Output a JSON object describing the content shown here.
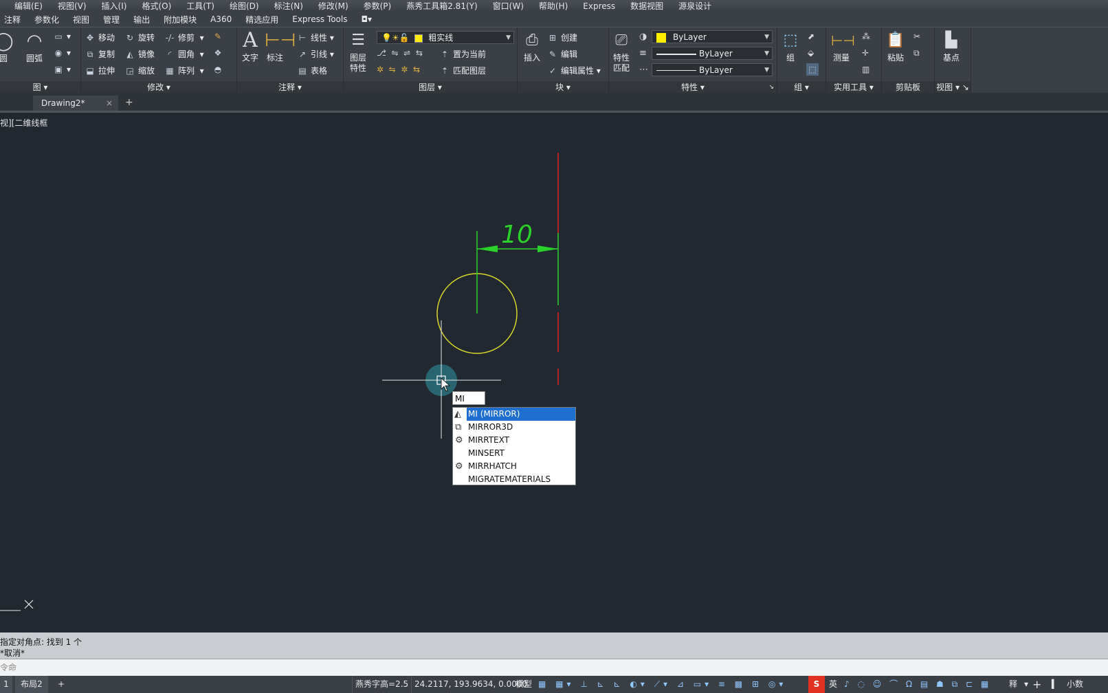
{
  "menubar": [
    "编辑(E)",
    "视图(V)",
    "插入(I)",
    "格式(O)",
    "工具(T)",
    "绘图(D)",
    "标注(N)",
    "修改(M)",
    "参数(P)",
    "燕秀工具箱2.81(Y)",
    "窗口(W)",
    "帮助(H)",
    "Express",
    "数据视图",
    "源泉设计"
  ],
  "ribbon_tabs": [
    "注释",
    "参数化",
    "视图",
    "管理",
    "输出",
    "附加模块",
    "A360",
    "精选应用",
    "Express Tools"
  ],
  "panels": {
    "draw": {
      "label": "图",
      "circle": "圆",
      "arc": "圆弧"
    },
    "modify": {
      "label": "修改",
      "move": "移动",
      "rotate": "旋转",
      "trim": "修剪",
      "copy": "复制",
      "mirror": "镜像",
      "fillet": "圆角",
      "stretch": "拉伸",
      "scale": "缩放",
      "array": "阵列"
    },
    "annotation": {
      "label": "注释",
      "text": "文字",
      "dimension": "标注",
      "linear": "线性",
      "leader": "引线",
      "table": "表格"
    },
    "layers": {
      "label": "图层",
      "layer_props": "图层\n特性",
      "current_layer": "粗实线",
      "set_current": "置为当前",
      "match_layer": "匹配图层"
    },
    "block": {
      "label": "块",
      "insert": "插入",
      "create": "创建",
      "edit": "编辑",
      "edit_attr": "编辑属性"
    },
    "properties": {
      "label": "特性",
      "match": "特性\n匹配",
      "color": "ByLayer",
      "linetype": "ByLayer",
      "lineweight": "ByLayer"
    },
    "groups": {
      "label": "组",
      "group": "组"
    },
    "utilities": {
      "label": "实用工具",
      "measure": "测量"
    },
    "clipboard": {
      "label": "剪贴板",
      "paste": "粘贴"
    },
    "view": {
      "label": "视图",
      "base": "基点"
    }
  },
  "doc_tab": {
    "name": "Drawing2*",
    "close": "×",
    "add": "+"
  },
  "viewport_label": "视][二维线框",
  "drawing": {
    "dimension_text": "10"
  },
  "autocomplete": {
    "input": "MI",
    "items": [
      {
        "label": "MI (MIRROR)",
        "icon": "mirror-icon",
        "selected": true
      },
      {
        "label": "MIRROR3D",
        "icon": "mirror3d-icon",
        "selected": false
      },
      {
        "label": "MIRRTEXT",
        "icon": "gear-icon",
        "selected": false
      },
      {
        "label": "MINSERT",
        "icon": "",
        "selected": false
      },
      {
        "label": "MIRRHATCH",
        "icon": "gear-icon",
        "selected": false
      },
      {
        "label": "MIGRATEMATERIALS",
        "icon": "",
        "selected": false
      }
    ]
  },
  "command": {
    "history_line1": "指定对角点: 找到 1 个",
    "history_line2": "*取消*",
    "prompt": "令命"
  },
  "layout_tabs": [
    "1",
    "布局2",
    "+"
  ],
  "status": {
    "text_height": "燕秀字高=2.5",
    "coords": "24.2117, 193.9634, 0.0000",
    "model": "模型",
    "ime": "英",
    "annot": "释",
    "units": "小数"
  }
}
